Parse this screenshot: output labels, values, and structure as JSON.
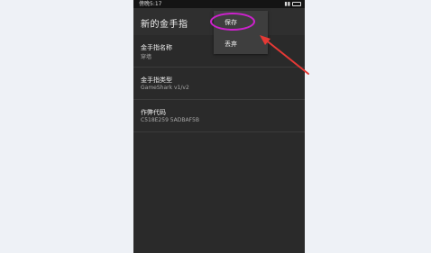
{
  "status_bar": {
    "time": "傍晚5:17",
    "battery_icon": "battery-icon",
    "signal_icon": "signal-icon"
  },
  "app_bar": {
    "title": "新的金手指"
  },
  "fields": [
    {
      "label": "金手指名称",
      "value": "穿墙"
    },
    {
      "label": "金手指类型",
      "value": "GameShark v1/v2"
    },
    {
      "label": "作弊代码",
      "value": "C518E259 5ADBAF5B"
    }
  ],
  "overflow_menu": {
    "items": [
      "保存",
      "丢弃"
    ]
  },
  "annotation": {
    "highlight_color": "#cc22cc",
    "arrow_color": "#e53935"
  }
}
